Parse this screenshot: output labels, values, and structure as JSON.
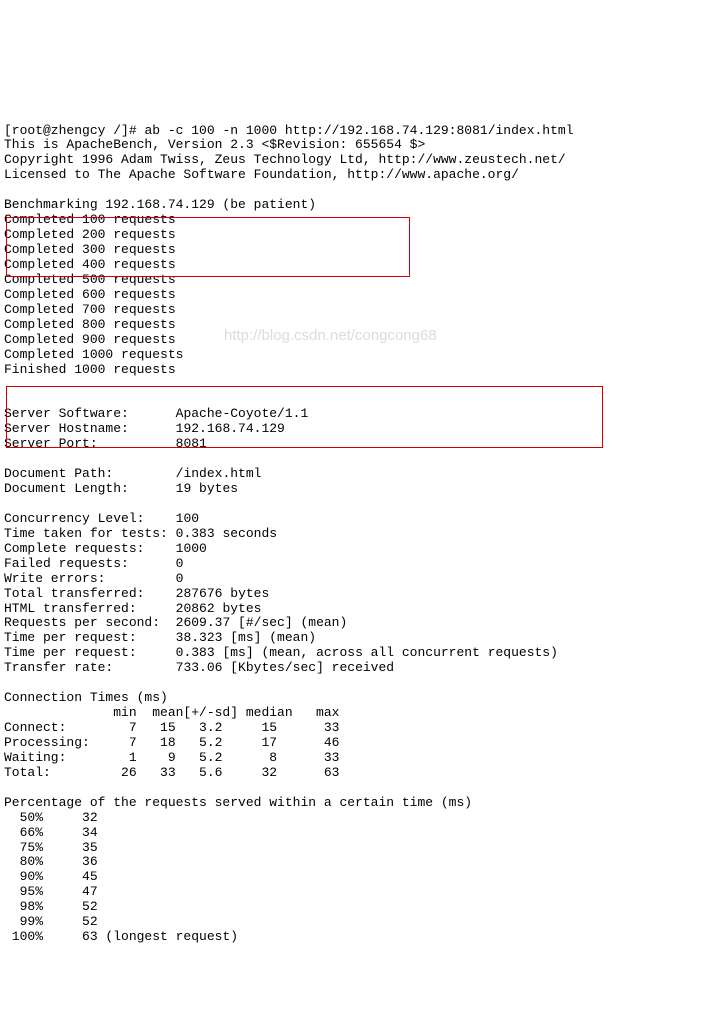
{
  "prompt": "[root@zhengcy /]# ",
  "command": "ab -c 100 -n 1000 http://192.168.74.129:8081/index.html",
  "header": {
    "l1": "This is ApacheBench, Version 2.3 <$Revision: 655654 $>",
    "l2": "Copyright 1996 Adam Twiss, Zeus Technology Ltd, http://www.zeustech.net/",
    "l3": "Licensed to The Apache Software Foundation, http://www.apache.org/"
  },
  "benchmarking": "Benchmarking 192.168.74.129 (be patient)",
  "progress": [
    "Completed 100 requests",
    "Completed 200 requests",
    "Completed 300 requests",
    "Completed 400 requests",
    "Completed 500 requests",
    "Completed 600 requests",
    "Completed 700 requests",
    "Completed 800 requests",
    "Completed 900 requests",
    "Completed 1000 requests",
    "Finished 1000 requests"
  ],
  "server": {
    "software_label": "Server Software:",
    "software_value": "Apache-Coyote/1.1",
    "hostname_label": "Server Hostname:",
    "hostname_value": "192.168.74.129",
    "port_label": "Server Port:",
    "port_value": "8081"
  },
  "document": {
    "path_label": "Document Path:",
    "path_value": "/index.html",
    "length_label": "Document Length:",
    "length_value": "19 bytes"
  },
  "stats": {
    "concurrency_label": "Concurrency Level:",
    "concurrency_value": "100",
    "time_taken_label": "Time taken for tests:",
    "time_taken_value": "0.383 seconds",
    "complete_label": "Complete requests:",
    "complete_value": "1000",
    "failed_label": "Failed requests:",
    "failed_value": "0",
    "write_errors_label": "Write errors:",
    "write_errors_value": "0",
    "total_trans_label": "Total transferred:",
    "total_trans_value": "287676 bytes",
    "html_trans_label": "HTML transferred:",
    "html_trans_value": "20862 bytes",
    "rps_label": "Requests per second:",
    "rps_value": "2609.37 [#/sec] (mean)",
    "tpr1_label": "Time per request:",
    "tpr1_value": "38.323 [ms] (mean)",
    "tpr2_label": "Time per request:",
    "tpr2_value": "0.383 [ms] (mean, across all concurrent requests)",
    "transfer_label": "Transfer rate:",
    "transfer_value": "733.06 [Kbytes/sec] received"
  },
  "conn_times": {
    "title": "Connection Times (ms)",
    "header": "              min  mean[+/-sd] median   max",
    "connect": "Connect:        7   15   3.2     15      33",
    "processing": "Processing:     7   18   5.2     17      46",
    "waiting": "Waiting:        1    9   5.2      8      33",
    "total": "Total:         26   33   5.6     32      63"
  },
  "percentiles": {
    "title": "Percentage of the requests served within a certain time (ms)",
    "rows": [
      "  50%     32",
      "  66%     34",
      "  75%     35",
      "  80%     36",
      "  90%     45",
      "  95%     47",
      "  98%     52",
      "  99%     52",
      " 100%     63 (longest request)"
    ]
  },
  "watermark": "http://blog.csdn.net/congcong68"
}
